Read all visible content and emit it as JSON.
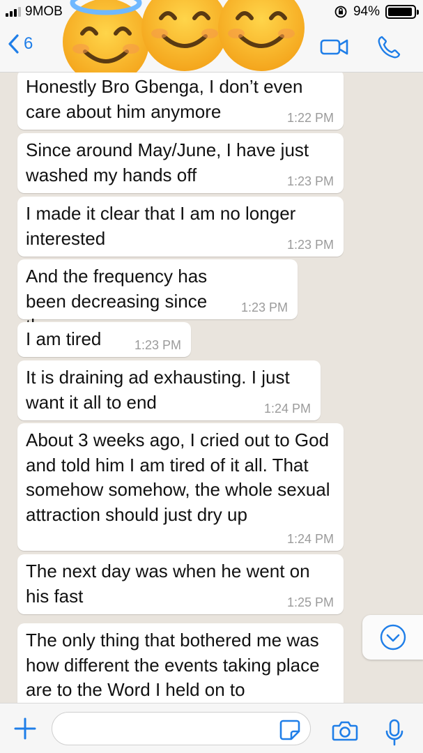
{
  "status_bar": {
    "carrier": "9MOB",
    "battery_percent": "94%",
    "battery_level": 0.94
  },
  "header": {
    "back_count": "6",
    "back_icon": "chevron-left-icon",
    "video_icon": "video-camera-icon",
    "call_icon": "phone-icon",
    "accent_color": "#1f7ee8"
  },
  "messages": [
    {
      "text": "Honestly Bro Gbenga, I don’t even care about him anymore",
      "time": "1:22 PM"
    },
    {
      "text": "Since around May/June, I have just washed my hands off",
      "time": "1:23 PM"
    },
    {
      "text": "I made it clear that I am no longer interested",
      "time": "1:23 PM"
    },
    {
      "text": "And the frequency has been decreasing since then",
      "time": "1:23 PM"
    },
    {
      "text": "I am tired",
      "time": "1:23 PM"
    },
    {
      "text": "It is draining ad exhausting. I just want it all to end",
      "time": "1:24 PM"
    },
    {
      "text": "About 3 weeks ago, I cried out to God and told him I am tired of it all. That somehow somehow, the whole sexual attraction should just dry up",
      "time": "1:24 PM"
    },
    {
      "text": "The next day was when he went on his fast",
      "time": "1:25 PM"
    },
    {
      "text": "The only thing that bothered me was how different the events taking place are to the Word I held on to",
      "time": ""
    }
  ],
  "input_bar": {
    "placeholder": "",
    "icons": [
      "plus-icon",
      "sticker-icon",
      "camera-icon",
      "microphone-icon"
    ]
  },
  "overlay": {
    "emojis": [
      "smiling-face-with-halo-emoji",
      "smiling-face-emoji",
      "smiling-face-emoji"
    ]
  }
}
